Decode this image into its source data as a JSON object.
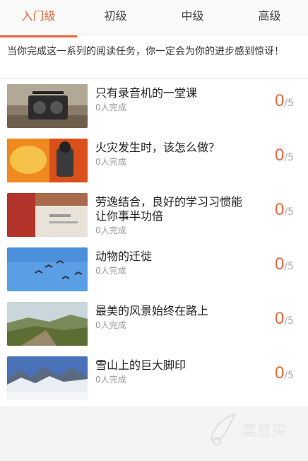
{
  "tabs": [
    {
      "label": "入门级",
      "active": true
    },
    {
      "label": "初级",
      "active": false
    },
    {
      "label": "中级",
      "active": false
    },
    {
      "label": "高级",
      "active": false
    }
  ],
  "intro": "当你完成这一系列的阅读任务，你一定会为你的进步感到惊讶！",
  "items": [
    {
      "title": "只有录音机的一堂课",
      "count": "0人完成",
      "score": "0",
      "total": "/5",
      "thumb": "radio"
    },
    {
      "title": "火灾发生时，该怎么做？",
      "count": "0人完成",
      "score": "0",
      "total": "/5",
      "thumb": "fire"
    },
    {
      "title": "劳逸结合，良好的学习习惯能让你事半功倍",
      "count": "0人完成",
      "score": "0",
      "total": "/5",
      "thumb": "study"
    },
    {
      "title": "动物的迁徙",
      "count": "0人完成",
      "score": "0",
      "total": "/5",
      "thumb": "birds"
    },
    {
      "title": "最美的风景始终在路上",
      "count": "0人完成",
      "score": "0",
      "total": "/5",
      "thumb": "landscape"
    },
    {
      "title": "雪山上的巨大脚印",
      "count": "0人完成",
      "score": "0",
      "total": "/5",
      "thumb": "snow"
    }
  ],
  "watermark": "菜豆买",
  "colors": {
    "accent": "#e8683a"
  }
}
